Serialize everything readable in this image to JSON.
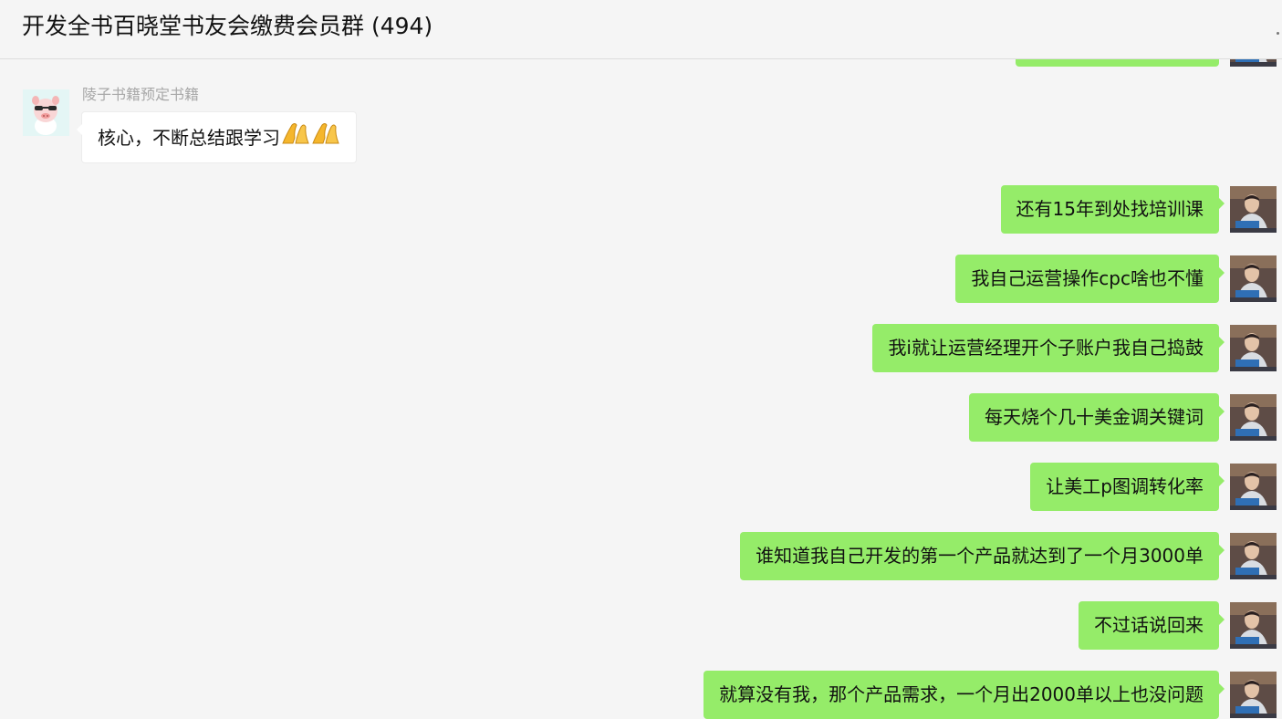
{
  "window": {
    "title": "开发全书百晓堂书友会缴费会员群 (494)"
  },
  "colors": {
    "self_bubble": "#95ec69",
    "other_bubble": "#ffffff",
    "background": "#f5f5f5"
  },
  "messages": [
    {
      "side": "left",
      "sender": "陵子书籍预定书籍",
      "text": "核心，不断总结跟学习",
      "emoji": [
        "folded-hands-icon",
        "folded-hands-icon"
      ]
    },
    {
      "side": "right",
      "text": "还有15年到处找培训课"
    },
    {
      "side": "right",
      "text": "我自己运营操作cpc啥也不懂"
    },
    {
      "side": "right",
      "text": "我i就让运营经理开个子账户我自己捣鼓"
    },
    {
      "side": "right",
      "text": "每天烧个几十美金调关键词"
    },
    {
      "side": "right",
      "text": "让美工p图调转化率"
    },
    {
      "side": "right",
      "text": "谁知道我自己开发的第一个产品就达到了一个月3000单"
    },
    {
      "side": "right",
      "text": "不过话说回来"
    },
    {
      "side": "right",
      "text": "就算没有我，那个产品需求，一个月出2000单以上也没问题"
    }
  ]
}
